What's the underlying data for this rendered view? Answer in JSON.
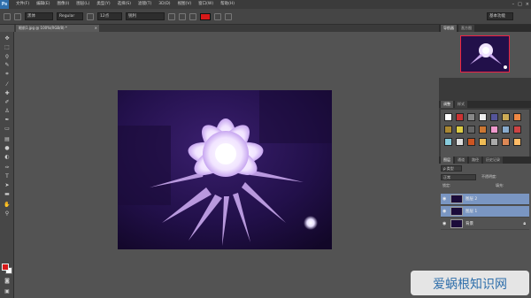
{
  "menubar": {
    "logo": "Ps",
    "items": [
      "文件(F)",
      "编辑(E)",
      "图像(I)",
      "图层(L)",
      "类型(Y)",
      "选择(S)",
      "滤镜(T)",
      "3D(D)",
      "视图(V)",
      "窗口(W)",
      "帮助(H)"
    ]
  },
  "options": {
    "font_name": "黑体",
    "font_style": "Regular",
    "font_size": "12点",
    "aa_mode": "锐利",
    "text_color": "#d81919",
    "workspace": "基本功能"
  },
  "document": {
    "tab_title": "眼前1.jpg @ 100%(RGB/8) *",
    "close": "×"
  },
  "panels": {
    "navigator_tabs": [
      "导航器",
      "直方图"
    ],
    "swatch_tabs": [
      "调整",
      "样式"
    ],
    "layers_tabs": [
      "图层",
      "通道",
      "路径",
      "历史记录"
    ],
    "kind_filter": "ρ 类型",
    "blend_mode": "正常",
    "opacity_label": "不透明度:",
    "lock_label": "锁定:",
    "fill_label": "填充:"
  },
  "layers": [
    {
      "name": "图层 2",
      "selected": true
    },
    {
      "name": "图层 1",
      "selected": true
    },
    {
      "name": "背景",
      "selected": false
    }
  ],
  "watermark": {
    "text": "爱蜗根知识网"
  },
  "colors": {
    "foreground": "#d81919",
    "background": "#ffffff",
    "accent_selection": "#7a96c2"
  }
}
